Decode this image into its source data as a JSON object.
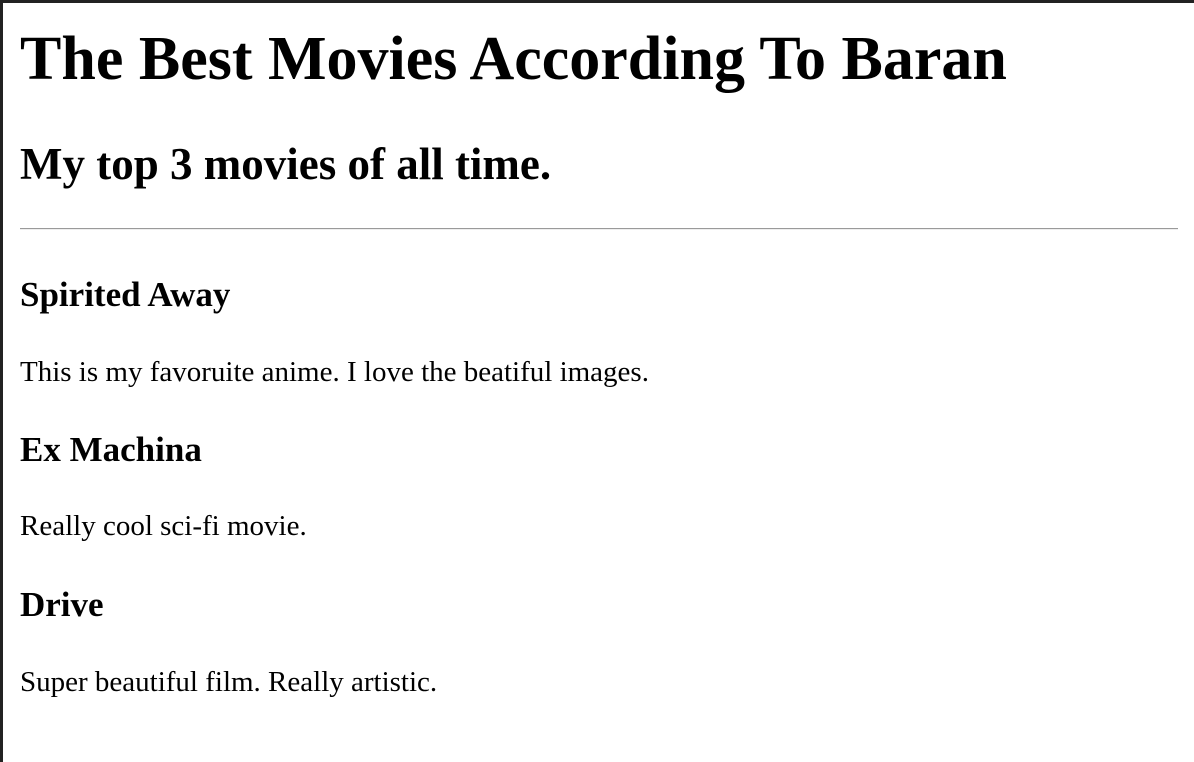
{
  "page": {
    "title": "The Best Movies According To Baran",
    "subtitle": "My top 3 movies of all time."
  },
  "movies": [
    {
      "title": "Spirited Away",
      "description": "This is my favoruite anime. I love the beatiful images."
    },
    {
      "title": "Ex Machina",
      "description": "Really cool sci-fi movie."
    },
    {
      "title": "Drive",
      "description": "Super beautiful film. Really artistic."
    }
  ]
}
